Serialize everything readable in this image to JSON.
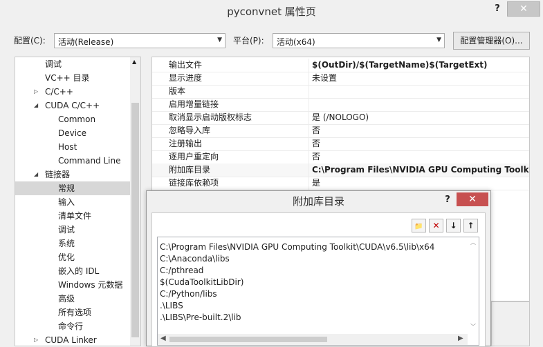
{
  "window": {
    "title": "pyconvnet 属性页",
    "help": "?",
    "close": "✕"
  },
  "toolbar": {
    "config_label": "配置(C):",
    "config_value": "活动(Release)",
    "platform_label": "平台(P):",
    "platform_value": "活动(x64)",
    "config_manager": "配置管理器(O)..."
  },
  "tree": {
    "items": [
      {
        "label": "调试",
        "level": 2
      },
      {
        "label": "VC++ 目录",
        "level": 2
      },
      {
        "label": "C/C++",
        "level": 1,
        "expander": "▷"
      },
      {
        "label": "CUDA C/C++",
        "level": 1,
        "expander": "◢"
      },
      {
        "label": "Common",
        "level": 3
      },
      {
        "label": "Device",
        "level": 3
      },
      {
        "label": "Host",
        "level": 3
      },
      {
        "label": "Command Line",
        "level": 3
      },
      {
        "label": "链接器",
        "level": 1,
        "expander": "◢"
      },
      {
        "label": "常规",
        "level": 3,
        "selected": true
      },
      {
        "label": "输入",
        "level": 3
      },
      {
        "label": "清单文件",
        "level": 3
      },
      {
        "label": "调试",
        "level": 3
      },
      {
        "label": "系统",
        "level": 3
      },
      {
        "label": "优化",
        "level": 3
      },
      {
        "label": "嵌入的 IDL",
        "level": 3
      },
      {
        "label": "Windows 元数据",
        "level": 3
      },
      {
        "label": "高级",
        "level": 3
      },
      {
        "label": "所有选项",
        "level": 3
      },
      {
        "label": "命令行",
        "level": 3
      },
      {
        "label": "CUDA Linker",
        "level": 1,
        "expander": "▷"
      }
    ]
  },
  "properties": [
    {
      "name": "输出文件",
      "value": "$(OutDir)/$(TargetName)$(TargetExt)",
      "bold": true
    },
    {
      "name": "显示进度",
      "value": "未设置"
    },
    {
      "name": "版本",
      "value": ""
    },
    {
      "name": "启用增量链接",
      "value": ""
    },
    {
      "name": "取消显示启动版权标志",
      "value": "是 (/NOLOGO)"
    },
    {
      "name": "忽略导入库",
      "value": "否"
    },
    {
      "name": "注册输出",
      "value": "否"
    },
    {
      "name": "逐用户重定向",
      "value": "否"
    },
    {
      "name": "附加库目录",
      "value": "C:\\Program Files\\NVIDIA GPU Computing Toolkit\\C",
      "bold": true
    },
    {
      "name": "链接库依赖项",
      "value": "是"
    }
  ],
  "dialog": {
    "title": "附加库目录",
    "help": "?",
    "close": "✕",
    "buttons": {
      "new_folder": "📁",
      "delete": "✕",
      "down": "↓",
      "up": "↑"
    },
    "entries": [
      "C:\\Program Files\\NVIDIA GPU Computing Toolkit\\CUDA\\v6.5\\lib\\x64",
      "C:\\Anaconda\\libs",
      "C:/pthread",
      "$(CudaToolkitLibDir)",
      "C:/Python/libs",
      ".\\LIBS",
      ".\\LIBS\\Pre-built.2\\lib"
    ]
  }
}
